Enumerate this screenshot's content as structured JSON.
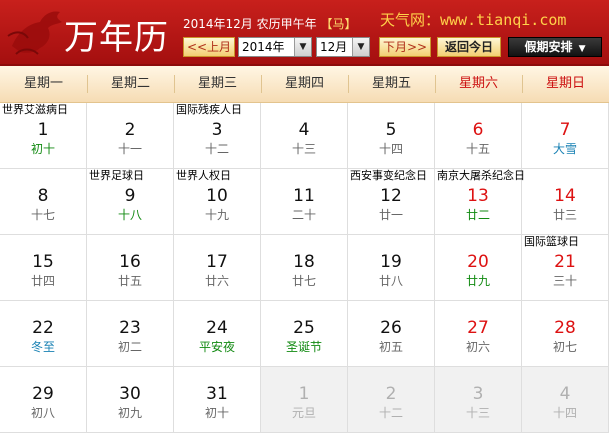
{
  "header": {
    "logo_text": "万年历",
    "date_info_prefix": "2014年12月 农历甲午年",
    "zodiac": "【马】",
    "site_text": "天气网：www.tianqi.com",
    "prev_month": "<<上月",
    "year_select": "2014年",
    "month_select": "12月",
    "next_month": "下月>>",
    "today_button": "返回今日",
    "holiday_button": "假期安排",
    "holiday_arrow": "▼",
    "select_arrow": "▼"
  },
  "weekdays": [
    "星期一",
    "星期二",
    "星期三",
    "星期四",
    "星期五",
    "星期六",
    "星期日"
  ],
  "weeks": [
    [
      {
        "day": "1",
        "lunar": "初十",
        "event": "世界艾滋病日",
        "lunar_class": "hl-green"
      },
      {
        "day": "2",
        "lunar": "十一"
      },
      {
        "day": "3",
        "lunar": "十二",
        "event": "国际残疾人日"
      },
      {
        "day": "4",
        "lunar": "十三"
      },
      {
        "day": "5",
        "lunar": "十四"
      },
      {
        "day": "6",
        "lunar": "十五",
        "weekend": true
      },
      {
        "day": "7",
        "lunar": "大雪",
        "weekend": true,
        "lunar_class": "hl-blue"
      }
    ],
    [
      {
        "day": "8",
        "lunar": "十七"
      },
      {
        "day": "9",
        "lunar": "十八",
        "event": "世界足球日",
        "lunar_class": "hl-green"
      },
      {
        "day": "10",
        "lunar": "十九",
        "event": "世界人权日"
      },
      {
        "day": "11",
        "lunar": "二十"
      },
      {
        "day": "12",
        "lunar": "廿一",
        "event": "西安事变纪念日"
      },
      {
        "day": "13",
        "lunar": "廿二",
        "event": "南京大屠杀纪念日",
        "weekend": true,
        "lunar_class": "hl-green"
      },
      {
        "day": "14",
        "lunar": "廿三",
        "weekend": true
      }
    ],
    [
      {
        "day": "15",
        "lunar": "廿四"
      },
      {
        "day": "16",
        "lunar": "廿五"
      },
      {
        "day": "17",
        "lunar": "廿六"
      },
      {
        "day": "18",
        "lunar": "廿七"
      },
      {
        "day": "19",
        "lunar": "廿八"
      },
      {
        "day": "20",
        "lunar": "廿九",
        "weekend": true,
        "lunar_class": "hl-green"
      },
      {
        "day": "21",
        "lunar": "三十",
        "event": "国际篮球日",
        "weekend": true
      }
    ],
    [
      {
        "day": "22",
        "lunar": "冬至",
        "lunar_class": "hl-blue"
      },
      {
        "day": "23",
        "lunar": "初二"
      },
      {
        "day": "24",
        "lunar": "平安夜",
        "lunar_class": "hl-green"
      },
      {
        "day": "25",
        "lunar": "圣诞节",
        "lunar_class": "hl-green"
      },
      {
        "day": "26",
        "lunar": "初五"
      },
      {
        "day": "27",
        "lunar": "初六",
        "weekend": true
      },
      {
        "day": "28",
        "lunar": "初七",
        "weekend": true
      }
    ],
    [
      {
        "day": "29",
        "lunar": "初八"
      },
      {
        "day": "30",
        "lunar": "初九"
      },
      {
        "day": "31",
        "lunar": "初十"
      },
      {
        "day": "1",
        "lunar": "元旦",
        "other": true,
        "lunar_class": "hl-red"
      },
      {
        "day": "2",
        "lunar": "十二",
        "other": true
      },
      {
        "day": "3",
        "lunar": "十三",
        "other": true
      },
      {
        "day": "4",
        "lunar": "十四",
        "other": true
      }
    ]
  ]
}
